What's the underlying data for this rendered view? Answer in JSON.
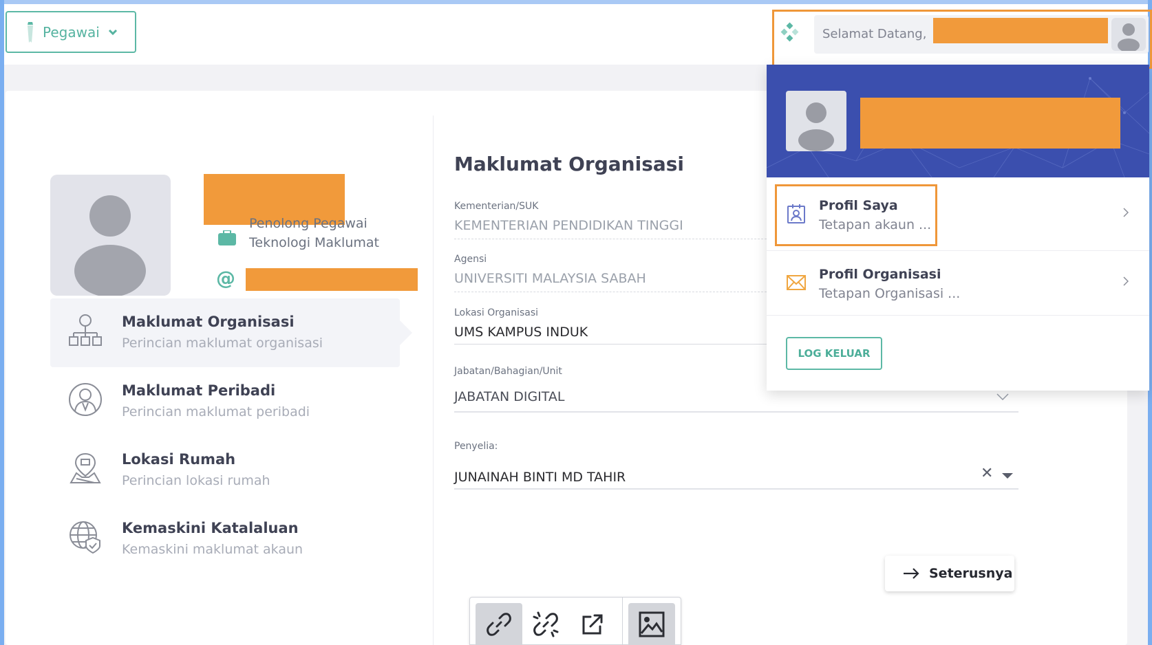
{
  "header": {
    "role_label": "Pegawai",
    "welcome_text": "Selamat Datang,"
  },
  "profile": {
    "job_title_line1": "Penolong Pegawai",
    "job_title_line2": "Teknologi Maklumat",
    "email_symbol": "@"
  },
  "menu": {
    "items": [
      {
        "title": "Maklumat Organisasi",
        "subtitle": "Perincian maklumat organisasi"
      },
      {
        "title": "Maklumat Peribadi",
        "subtitle": "Perincian maklumat peribadi"
      },
      {
        "title": "Lokasi Rumah",
        "subtitle": "Perincian lokasi rumah"
      },
      {
        "title": "Kemaskini Katalaluan",
        "subtitle": "Kemaskini maklumat akaun"
      }
    ]
  },
  "form": {
    "title": "Maklumat Organisasi",
    "fields": [
      {
        "label": "Kementerian/SUK",
        "value": "KEMENTERIAN PENDIDIKAN TINGGI"
      },
      {
        "label": "Agensi",
        "value": "UNIVERSITI MALAYSIA SABAH"
      },
      {
        "label": "Lokasi Organisasi",
        "value": "UMS KAMPUS INDUK"
      },
      {
        "label": "Jabatan/Bahagian/Unit",
        "value": "JABATAN DIGITAL"
      },
      {
        "label": "Penyelia:",
        "value": "JUNAINAH BINTI MD TAHIR"
      }
    ],
    "clear_symbol": "✕",
    "next_label": "Seterusnya"
  },
  "dropdown": {
    "items": [
      {
        "title": "Profil Saya",
        "subtitle": "Tetapan akaun ..."
      },
      {
        "title": "Profil Organisasi",
        "subtitle": "Tetapan Organisasi ..."
      }
    ],
    "logout_label": "LOG KELUAR"
  },
  "colors": {
    "accent_teal": "#5cb8a5",
    "highlight_orange": "#ef9739",
    "redaction_orange": "#f19a3b",
    "banner_blue": "#3a4fa8"
  },
  "icons": {
    "role": "tie-icon",
    "menu": [
      "org-chart-icon",
      "person-circle-icon",
      "map-pin-icon",
      "globe-shield-icon"
    ],
    "dropdown": [
      "id-card-icon",
      "envelope-icon"
    ],
    "toolbar": [
      "link-icon",
      "unlink-icon",
      "external-link-icon",
      "image-icon"
    ]
  }
}
